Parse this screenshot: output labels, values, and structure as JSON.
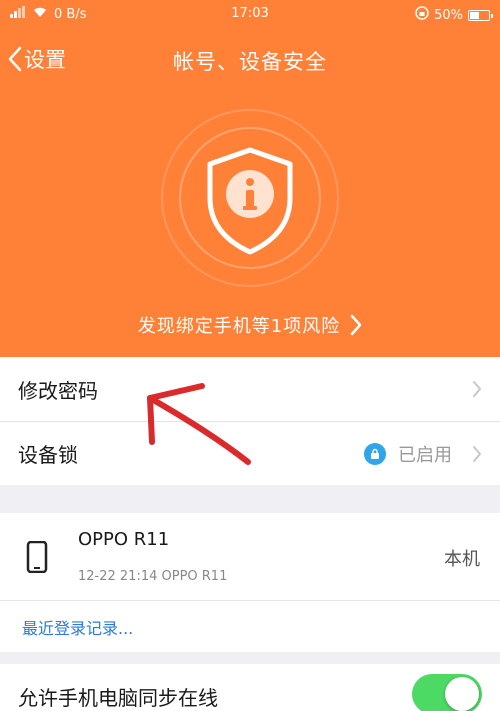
{
  "status_bar": {
    "net_speed": "0 B/s",
    "time": "17:03",
    "battery": "50%"
  },
  "nav": {
    "back_label": "设置",
    "title": "帐号、设备安全"
  },
  "security": {
    "risk_text": "发现绑定手机等1项风险"
  },
  "settings": {
    "change_password": "修改密码",
    "device_lock": "设备锁",
    "device_lock_status": "已启用"
  },
  "device": {
    "name": "OPPO R11",
    "last_login": "12-22 21:14 OPPO R11",
    "tag": "本机"
  },
  "recent_login_link": "最近登录记录...",
  "sync": {
    "label": "允许手机电脑同步在线",
    "enabled": true
  },
  "colors": {
    "header_orange": "#ff8138",
    "toggle_green": "#4cd964",
    "link_blue": "#2d7bd6",
    "annotation_red": "#d92b2b"
  }
}
